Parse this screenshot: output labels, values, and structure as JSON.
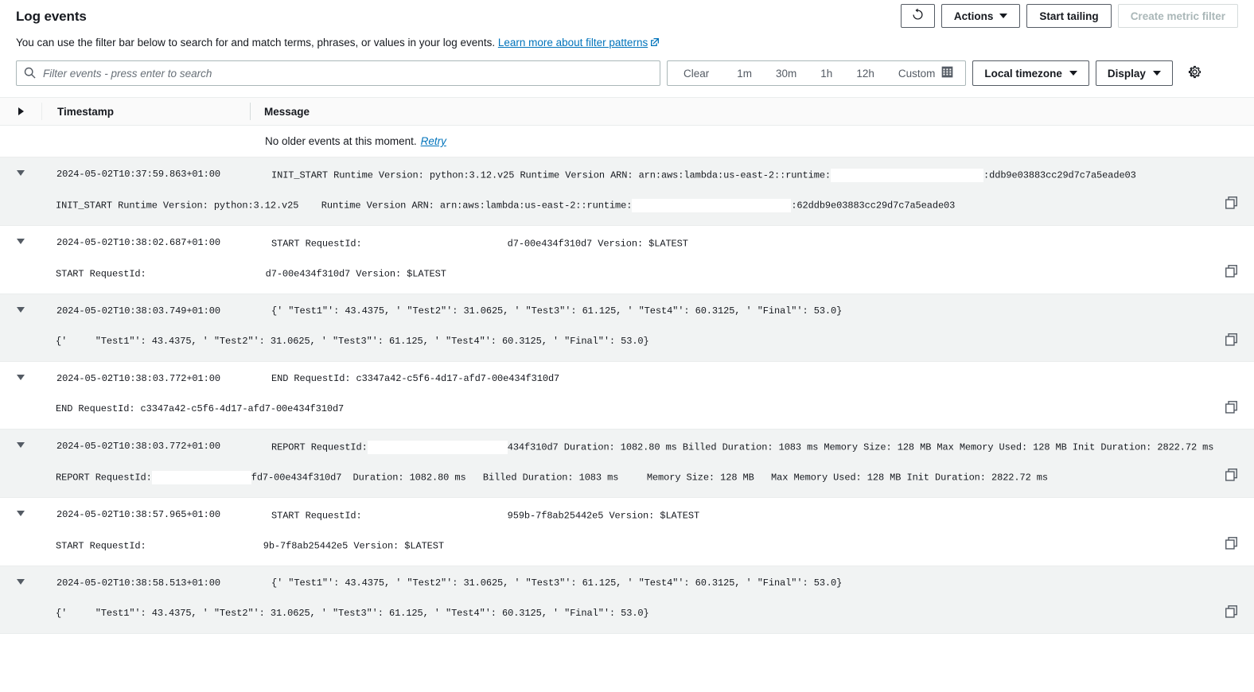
{
  "header": {
    "title": "Log events",
    "description_prefix": "You can use the filter bar below to search for and match terms, phrases, or values in your log events.",
    "learn_more_label": "Learn more about filter patterns",
    "refresh_icon": "refresh-icon",
    "actions_label": "Actions",
    "start_tailing_label": "Start tailing",
    "create_metric_filter_label": "Create metric filter"
  },
  "filterbar": {
    "search_placeholder": "Filter events - press enter to search",
    "search_value": "",
    "search_icon": "search-icon",
    "range_options": [
      "Clear",
      "1m",
      "30m",
      "1h",
      "12h",
      "Custom"
    ],
    "calendar_icon": "calendar-icon",
    "timezone_label": "Local timezone",
    "display_label": "Display",
    "settings_icon": "gear-icon"
  },
  "table": {
    "columns": {
      "toggle_icon": "chevron-right-icon",
      "timestamp": "Timestamp",
      "message": "Message"
    },
    "no_older_events_text": "No older events at this moment.",
    "retry_label": "Retry",
    "copy_icon": "copy-icon",
    "expand_icon": "chevron-down-icon"
  },
  "events": [
    {
      "timestamp": "2024-05-02T10:37:59.863+01:00",
      "message_pre": "INIT_START Runtime Version: python:3.12.v25 Runtime Version ARN: arn:aws:lambda:us-east-2::runtime:",
      "message_redacted_width": 192,
      "message_post": ":ddb9e03883cc29d7c7a5eade03",
      "message_indent": 27,
      "detail_pre": "INIT_START Runtime Version: python:3.12.v25    Runtime Version ARN: arn:aws:lambda:us-east-2::runtime:",
      "detail_redacted_width": 200,
      "detail_post": ":62ddb9e03883cc29d7c7a5eade03",
      "detail_indent": 0,
      "shaded": true
    },
    {
      "timestamp": "2024-05-02T10:38:02.687+01:00",
      "message_pre": "START RequestId:",
      "message_redacted_width": 183,
      "message_post": "d7-00e434f310d7 Version: $LATEST",
      "message_indent": 27,
      "detail_pre": "START RequestId:",
      "detail_redacted_width": 150,
      "detail_post": "d7-00e434f310d7 Version: $LATEST",
      "detail_indent": 0,
      "shaded": false
    },
    {
      "timestamp": "2024-05-02T10:38:03.749+01:00",
      "message_pre": "{' \"Test1\"': 43.4375, ' \"Test2\"': 31.0625, ' \"Test3\"': 61.125, ' \"Test4\"': 60.3125, ' \"Final\"': 53.0}",
      "message_redacted_width": 0,
      "message_post": "",
      "message_indent": 27,
      "detail_pre": "{'     \"Test1\"': 43.4375, ' \"Test2\"': 31.0625, ' \"Test3\"': 61.125, ' \"Test4\"': 60.3125, ' \"Final\"': 53.0}",
      "detail_redacted_width": 0,
      "detail_post": "",
      "detail_indent": 0,
      "shaded": true
    },
    {
      "timestamp": "2024-05-02T10:38:03.772+01:00",
      "message_pre": "END RequestId: c3347a42-c5f6-4d17-afd7-00e434f310d7",
      "message_redacted_width": 0,
      "message_post": "",
      "message_indent": 27,
      "detail_pre": "END RequestId: c3347a42-c5f6-4d17-afd7-00e434f310d7",
      "detail_redacted_width": 0,
      "detail_post": "",
      "detail_indent": 0,
      "shaded": false
    },
    {
      "timestamp": "2024-05-02T10:38:03.772+01:00",
      "message_pre": "REPORT RequestId:",
      "message_redacted_width": 176,
      "message_post": "434f310d7 Duration: 1082.80 ms Billed Duration: 1083 ms Memory Size: 128 MB Max Memory Used: 128 MB Init Duration: 2822.72 ms",
      "message_indent": 27,
      "detail_pre": "REPORT RequestId:",
      "detail_redacted_width": 125,
      "detail_post": "fd7-00e434f310d7  Duration: 1082.80 ms   Billed Duration: 1083 ms     Memory Size: 128 MB   Max Memory Used: 128 MB Init Duration: 2822.72 ms",
      "detail_indent": 0,
      "shaded": true
    },
    {
      "timestamp": "2024-05-02T10:38:57.965+01:00",
      "message_pre": "START RequestId:",
      "message_redacted_width": 183,
      "message_post": "959b-7f8ab25442e5 Version: $LATEST",
      "message_indent": 27,
      "detail_pre": "START RequestId: ",
      "detail_redacted_width": 140,
      "detail_post": "9b-7f8ab25442e5 Version: $LATEST",
      "detail_indent": 0,
      "shaded": false
    },
    {
      "timestamp": "2024-05-02T10:38:58.513+01:00",
      "message_pre": "{' \"Test1\"': 43.4375, ' \"Test2\"': 31.0625, ' \"Test3\"': 61.125, ' \"Test4\"': 60.3125, ' \"Final\"': 53.0}",
      "message_redacted_width": 0,
      "message_post": "",
      "message_indent": 27,
      "detail_pre": "{'     \"Test1\"': 43.4375, ' \"Test2\"': 31.0625, ' \"Test3\"': 61.125, ' \"Test4\"': 60.3125, ' \"Final\"': 53.0}",
      "detail_redacted_width": 0,
      "detail_post": "",
      "detail_indent": 0,
      "shaded": true
    }
  ],
  "colors": {
    "link": "#0073bb",
    "text": "#16191f",
    "muted": "#545b64",
    "border": "#aab7b8",
    "row_shade": "#f1f3f3",
    "disabled": "#aab7b8"
  }
}
